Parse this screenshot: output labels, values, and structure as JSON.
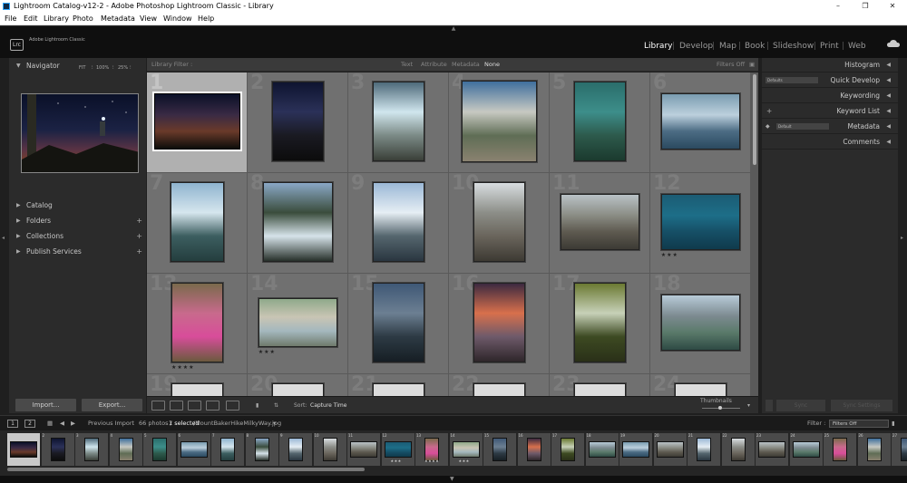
{
  "window": {
    "title": "Lightroom Catalog-v12-2 - Adobe Photoshop Lightroom Classic - Library",
    "controls": [
      "–",
      "❐",
      "✕"
    ]
  },
  "menu": [
    "File",
    "Edit",
    "Library",
    "Photo",
    "Metadata",
    "View",
    "Window",
    "Help"
  ],
  "identity": {
    "badge": "Lrc",
    "brand": "Adobe Lightroom Classic"
  },
  "modules": [
    {
      "label": "Library",
      "active": true
    },
    {
      "label": "Develop",
      "active": false
    },
    {
      "label": "Map",
      "active": false
    },
    {
      "label": "Book",
      "active": false
    },
    {
      "label": "Slideshow",
      "active": false
    },
    {
      "label": "Print",
      "active": false
    },
    {
      "label": "Web",
      "active": false
    }
  ],
  "left_panel": {
    "navigator": {
      "title": "Navigator",
      "zoom": [
        "FIT",
        "100%",
        "25%"
      ]
    },
    "sections": [
      {
        "label": "Catalog",
        "plus": ""
      },
      {
        "label": "Folders",
        "plus": "+"
      },
      {
        "label": "Collections",
        "plus": "+"
      },
      {
        "label": "Publish Services",
        "plus": "+"
      }
    ],
    "import_label": "Import...",
    "export_label": "Export..."
  },
  "filter_bar": {
    "title": "Library Filter :",
    "options": [
      "Text",
      "Attribute",
      "Metadata",
      "None"
    ],
    "selected": "None",
    "filters_off": "Filters Off"
  },
  "grid": {
    "cells": [
      {
        "n": "1",
        "stars": "",
        "thumb": "milkyway-hiker"
      },
      {
        "n": "2",
        "stars": "",
        "thumb": "milkyway-portrait"
      },
      {
        "n": "3",
        "stars": "",
        "thumb": "waterfall"
      },
      {
        "n": "4",
        "stars": "",
        "thumb": "lake-mountain"
      },
      {
        "n": "5",
        "stars": "",
        "thumb": "teal-lake"
      },
      {
        "n": "6",
        "stars": "",
        "thumb": "kayak-lake"
      },
      {
        "n": "7",
        "stars": "",
        "thumb": "island-lake"
      },
      {
        "n": "8",
        "stars": "",
        "thumb": "river-canyon"
      },
      {
        "n": "9",
        "stars": "",
        "thumb": "mountain-reflection"
      },
      {
        "n": "10",
        "stars": "",
        "thumb": "ridge-hiker"
      },
      {
        "n": "11",
        "stars": "",
        "thumb": "rocky-ridge"
      },
      {
        "n": "12",
        "stars": "★★★",
        "thumb": "aerial-water"
      },
      {
        "n": "13",
        "stars": "★★★★",
        "thumb": "girl-portrait"
      },
      {
        "n": "14",
        "stars": "★★★",
        "thumb": "alpacas"
      },
      {
        "n": "15",
        "stars": "",
        "thumb": "dusk-lake"
      },
      {
        "n": "16",
        "stars": "",
        "thumb": "sunset-lake"
      },
      {
        "n": "17",
        "stars": "",
        "thumb": "forest-stream"
      },
      {
        "n": "18",
        "stars": "",
        "thumb": "mountain-valley"
      },
      {
        "n": "19",
        "stars": "",
        "thumb": "partial"
      },
      {
        "n": "20",
        "stars": "",
        "thumb": "partial"
      },
      {
        "n": "21",
        "stars": "",
        "thumb": "partial"
      },
      {
        "n": "22",
        "stars": "",
        "thumb": "partial"
      },
      {
        "n": "23",
        "stars": "",
        "thumb": "partial"
      },
      {
        "n": "24",
        "stars": "",
        "thumb": "partial"
      }
    ]
  },
  "toolbar": {
    "sort_label": "Sort:",
    "sort_value": "Capture Time",
    "thumbnails_label": "Thumbnails"
  },
  "right_panel": {
    "sections": [
      "Histogram",
      "Quick Develop",
      "Keywording",
      "Keyword List",
      "Metadata",
      "Comments"
    ],
    "quick_develop_preset": "Defaults",
    "metadata_preset": "Default",
    "sync_label": "Sync",
    "sync_settings_label": "Sync Settings"
  },
  "filmstrip_bar": {
    "box1": "1",
    "box2": "2",
    "source": "Previous Import",
    "count": "66 photos /",
    "selected": "1 selected",
    "filename": "/MountBakerHikeMilkyWay.jpg",
    "filter_label": "Filter :",
    "filter_value": "Filters Off"
  },
  "filmstrip": {
    "numbers": [
      "1",
      "2",
      "3",
      "4",
      "5",
      "6",
      "7",
      "8",
      "9",
      "10",
      "11",
      "12",
      "13",
      "14",
      "15",
      "16",
      "17",
      "18",
      "19",
      "20",
      "21",
      "22",
      "23",
      "24",
      "25",
      "26",
      "27"
    ],
    "stars": {
      "12": "★★★",
      "13": "★★★★",
      "14": "★★★"
    }
  },
  "colors": {
    "accent": "#ffffff",
    "panel": "#2b2b2b",
    "grid_bg": "#6a6a6a",
    "selected_cell": "#b0b0b0"
  }
}
